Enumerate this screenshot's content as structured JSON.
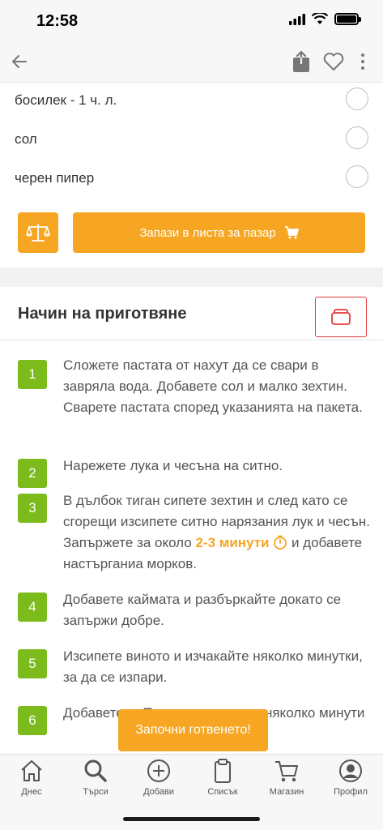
{
  "status": {
    "time": "12:58"
  },
  "ingredients": [
    {
      "label": "босилек - 1 ч. л."
    },
    {
      "label": "сол"
    },
    {
      "label": "черен пипер"
    }
  ],
  "actions": {
    "save_label": "Запази в листа за пазар"
  },
  "method": {
    "title": "Начин на приготвяне",
    "steps": [
      {
        "num": "1",
        "text": "Сложете пастата от нахут да се свари в завряла вода. Добавете сол и малко зехтин. Сварете пастата според указанията на пакета."
      },
      {
        "num": "2",
        "text": "Нарежете лука и чесъна на ситно."
      },
      {
        "num": "3",
        "text_before": "В дълбок тиган сипете зехтин и след като се сгорещи изсипете ситно нарязания лук и чесън. Запържете за около ",
        "timer": "2-3 минути",
        "text_after": " и добавете настърганиа морков."
      },
      {
        "num": "4",
        "text": "Добавете каймата и разбъркайте докато се запържи добре."
      },
      {
        "num": "5",
        "text": "Изсипете виното и изчакайте няколко минутки, за да се изпари."
      },
      {
        "num": "6",
        "text": "Добавете ... Подправете ... при няколко минути"
      }
    ]
  },
  "toast": {
    "label": "Започни готвенето!"
  },
  "tabs": [
    {
      "label": "Днес",
      "icon": "home-icon"
    },
    {
      "label": "Търси",
      "icon": "search-icon"
    },
    {
      "label": "Добави",
      "icon": "add-icon"
    },
    {
      "label": "Списък",
      "icon": "clipboard-icon"
    },
    {
      "label": "Магазин",
      "icon": "cart-icon"
    },
    {
      "label": "Профил",
      "icon": "profile-icon"
    }
  ],
  "colors": {
    "accent": "#f6a623",
    "step_green": "#7cbb1c",
    "cook_red": "#e4393b"
  }
}
